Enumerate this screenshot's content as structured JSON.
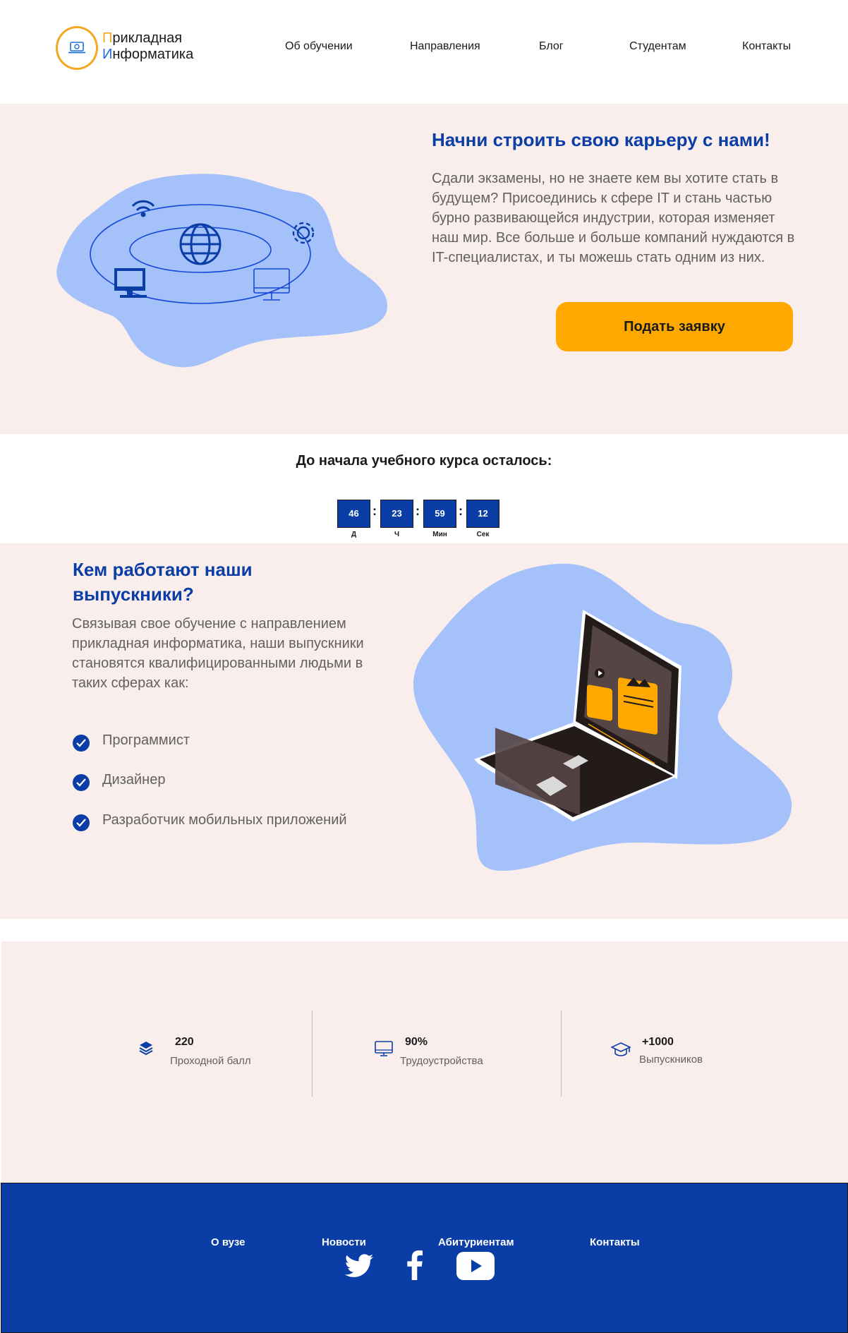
{
  "header": {
    "logo": {
      "line1_first": "П",
      "line1_rest": "рикладная",
      "line2_first": "И",
      "line2_rest": "нформатика"
    },
    "nav": [
      "Об обучении",
      "Направления",
      "Блог",
      "Студентам",
      "Контакты"
    ]
  },
  "hero": {
    "title": "Начни строить свою карьеру с нами!",
    "text": "Сдали экзамены, но не знаете кем вы хотите стать в будущем? Присоединись к сфере IT и стань частью бурно развивающейся индустрии, которая изменяет наш мир. Все больше и больше компаний нуждаются в IT-специалистах, и ты можешь стать одним из них.",
    "cta_label": "Подать заявку"
  },
  "countdown": {
    "title": "До начала учебного курса осталось:",
    "units": [
      {
        "value": "46",
        "label": "Д"
      },
      {
        "value": "23",
        "label": "Ч"
      },
      {
        "value": "59",
        "label": "Мин"
      },
      {
        "value": "12",
        "label": "Сек"
      }
    ],
    "separator": ":"
  },
  "graduates": {
    "title": "Кем работают наши выпускники?",
    "text": "Связывая свое обучение с направлением прикладная информатика, наши выпускники становятся квалифицированными людьми в таких сферах как:",
    "items": [
      "Программист",
      "Дизайнер",
      "Разработчик мобильных приложений"
    ]
  },
  "stats": [
    {
      "icon": "book-stack-icon",
      "value": "220",
      "label": "Проходной балл"
    },
    {
      "icon": "monitor-icon",
      "value": "90%",
      "label": "Трудоустройства"
    },
    {
      "icon": "graduation-cap-icon",
      "value": "+1000",
      "label": "Выпускников"
    }
  ],
  "footer": {
    "links": [
      "О вузе",
      "Новости",
      "Абитуриентам",
      "Контакты"
    ],
    "social": [
      "twitter-icon",
      "facebook-icon",
      "youtube-icon"
    ]
  },
  "colors": {
    "brand_blue": "#0a3ea6",
    "accent_orange": "#ffa900",
    "section_pink": "#faeeed",
    "blob_blue": "#a4c1fa"
  }
}
